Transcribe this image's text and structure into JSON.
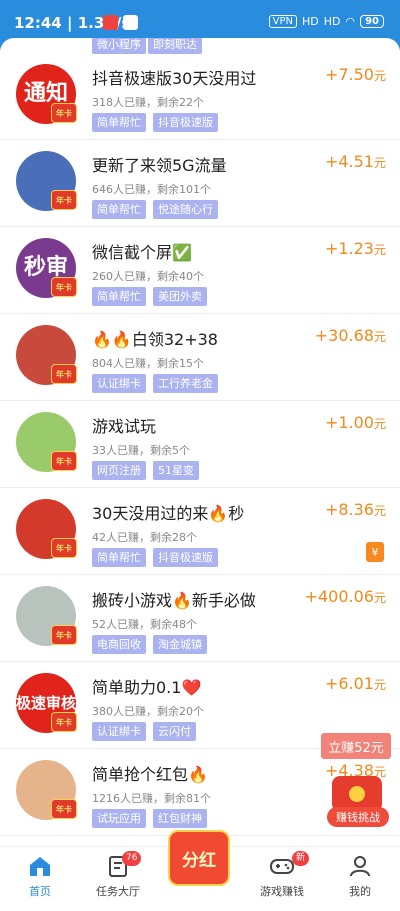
{
  "status": {
    "time": "12:44",
    "speed": "1.3K/s",
    "vpn": "VPN",
    "signal1": "HD",
    "signal2": "HD",
    "battery": "90"
  },
  "partial_row": {
    "tags": [
      "微小程序",
      "即刻职达"
    ]
  },
  "rows": [
    {
      "title": "抖音极速版30天没用过",
      "meta": "318人已赚，剩余22个",
      "tags": [
        "简单帮忙",
        "抖音极速版"
      ],
      "price": "+7.50",
      "avatar_text": "通知",
      "avatar_bg": "#e0231b"
    },
    {
      "title": "更新了来领5G流量",
      "meta": "646人已赚，剩余101个",
      "tags": [
        "简单帮忙",
        "悦途随心行"
      ],
      "price": "+4.51",
      "avatar_text": "",
      "avatar_bg": "#4a6fb8"
    },
    {
      "title": "微信截个屏✅",
      "meta": "260人已赚，剩余40个",
      "tags": [
        "简单帮忙",
        "美团外卖"
      ],
      "price": "+1.23",
      "avatar_text": "秒审",
      "avatar_bg": "#7a3a8e"
    },
    {
      "title": "🔥🔥白领32+38",
      "meta": "804人已赚，剩余15个",
      "tags": [
        "认证绑卡",
        "工行养老金"
      ],
      "price": "+30.68",
      "avatar_text": "",
      "avatar_bg": "#c84a3c"
    },
    {
      "title": "游戏试玩",
      "meta": "33人已赚，剩余5个",
      "tags": [
        "网页注册",
        "51星变"
      ],
      "price": "+1.00",
      "avatar_text": "",
      "avatar_bg": "#9acb6a"
    },
    {
      "title": "30天没用过的来🔥秒",
      "meta": "42人已赚，剩余28个",
      "tags": [
        "简单帮忙",
        "抖音极速版"
      ],
      "price": "+8.36",
      "avatar_text": "",
      "avatar_bg": "#d43a2c"
    },
    {
      "title": "搬砖小游戏🔥新手必做",
      "meta": "52人已赚，剩余48个",
      "tags": [
        "电商回收",
        "淘金城镇"
      ],
      "price": "+400.06",
      "avatar_text": "",
      "avatar_bg": "#b9c3bd"
    },
    {
      "title": "简单助力0.1❤️",
      "meta": "380人已赚，剩余20个",
      "tags": [
        "认证绑卡",
        "云闪付"
      ],
      "price": "+6.01",
      "avatar_text": "极速审核",
      "avatar_bg": "#e0231b"
    },
    {
      "title": "简单抢个红包🔥",
      "meta": "1216人已赚，剩余81个",
      "tags": [
        "试玩应用",
        "红包财神"
      ],
      "price": "+4.38",
      "avatar_text": "",
      "avatar_bg": "#e6b48a"
    }
  ],
  "badge_text": "年卡",
  "price_unit": "元",
  "yen_icon": "¥",
  "promo": "立赚52元",
  "hongbao_label": "赚钱挑战",
  "tabs": [
    {
      "label": "首页"
    },
    {
      "label": "任务大厅",
      "badge": "76"
    },
    {
      "label": "分红"
    },
    {
      "label": "游戏赚钱",
      "badge": "新"
    },
    {
      "label": "我的"
    }
  ],
  "colors": {
    "accent": "#2a8cdc",
    "price": "#f08a1c",
    "tag": "#aab3ef"
  }
}
